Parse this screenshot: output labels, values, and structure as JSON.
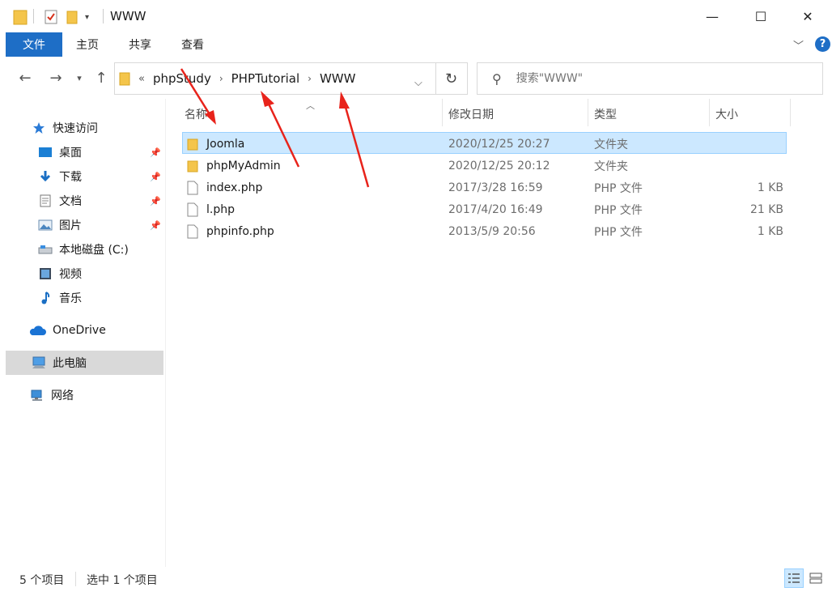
{
  "window": {
    "title": "WWW",
    "minimize": "—",
    "maximize": "☐",
    "close": "✕"
  },
  "ribbon": {
    "file": "文件",
    "tabs": [
      "主页",
      "共享",
      "查看"
    ],
    "help": "?"
  },
  "address": {
    "overflow": "«",
    "crumbs": [
      "phpStudy",
      "PHPTutorial",
      "WWW"
    ]
  },
  "search": {
    "placeholder": "搜索\"WWW\""
  },
  "sidebar": {
    "items": [
      {
        "label": "快速访问",
        "icon": "star-icon"
      },
      {
        "label": "桌面",
        "icon": "desktop-icon",
        "pinned": true
      },
      {
        "label": "下载",
        "icon": "download-icon",
        "pinned": true
      },
      {
        "label": "文档",
        "icon": "document-icon",
        "pinned": true
      },
      {
        "label": "图片",
        "icon": "pictures-icon",
        "pinned": true
      },
      {
        "label": "本地磁盘 (C:)",
        "icon": "drive-icon"
      },
      {
        "label": "视频",
        "icon": "video-icon"
      },
      {
        "label": "音乐",
        "icon": "music-icon"
      },
      {
        "label": "OneDrive",
        "icon": "cloud-icon"
      },
      {
        "label": "此电脑",
        "icon": "computer-icon",
        "selected": true
      },
      {
        "label": "网络",
        "icon": "network-icon"
      }
    ]
  },
  "columns": {
    "name": "名称",
    "modified": "修改日期",
    "type": "类型",
    "size": "大小"
  },
  "files": [
    {
      "name": "Joomla",
      "modified": "2020/12/25 20:27",
      "type": "文件夹",
      "size": "",
      "kind": "folder",
      "selected": true
    },
    {
      "name": "phpMyAdmin",
      "modified": "2020/12/25 20:12",
      "type": "文件夹",
      "size": "",
      "kind": "folder"
    },
    {
      "name": "index.php",
      "modified": "2017/3/28 16:59",
      "type": "PHP 文件",
      "size": "1 KB",
      "kind": "file"
    },
    {
      "name": "l.php",
      "modified": "2017/4/20 16:49",
      "type": "PHP 文件",
      "size": "21 KB",
      "kind": "file"
    },
    {
      "name": "phpinfo.php",
      "modified": "2013/5/9 20:56",
      "type": "PHP 文件",
      "size": "1 KB",
      "kind": "file"
    }
  ],
  "status": {
    "count": "5 个项目",
    "selected": "选中 1 个项目"
  },
  "colors": {
    "accent": "#1e6ec6",
    "selection": "#cce8ff",
    "annotation": "#e8231b"
  }
}
